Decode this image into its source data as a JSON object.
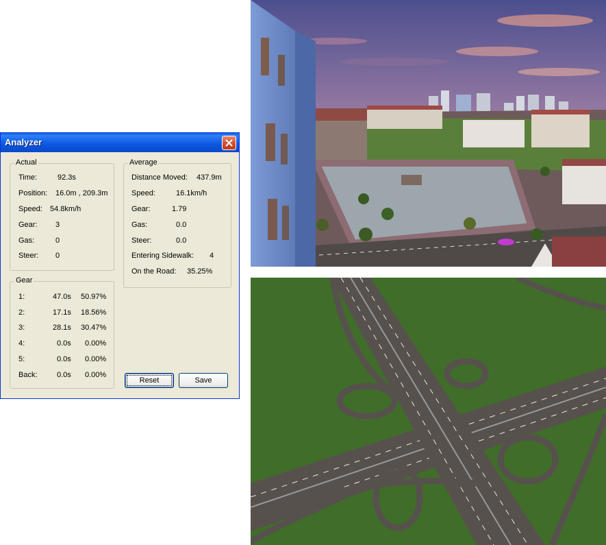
{
  "window": {
    "title": "Analyzer",
    "close_icon": "close-icon"
  },
  "actual": {
    "title": "Actual",
    "rows": [
      {
        "label": "Time:",
        "value": "92.3s"
      },
      {
        "label": "Position:",
        "value": "16.0m , 209.3m"
      },
      {
        "label": "Speed:",
        "value": "54.8km/h"
      },
      {
        "label": "Gear:",
        "value": "3"
      },
      {
        "label": "Gas:",
        "value": "0"
      },
      {
        "label": "Steer:",
        "value": "0"
      }
    ]
  },
  "average": {
    "title": "Average",
    "rows": [
      {
        "label": "Distance Moved:",
        "value": "437.9m"
      },
      {
        "label": "Speed:",
        "value": "16.1km/h"
      },
      {
        "label": "Gear:",
        "value": "1.79"
      },
      {
        "label": "Gas:",
        "value": "0.0"
      },
      {
        "label": "Steer:",
        "value": "0.0"
      },
      {
        "label": "Entering Sidewalk:",
        "value": "4"
      },
      {
        "label": "On the Road:",
        "value": "35.25%"
      }
    ]
  },
  "gear": {
    "title": "Gear",
    "rows": [
      {
        "label": "1:",
        "time": "47.0s",
        "percent": "50.97%"
      },
      {
        "label": "2:",
        "time": "17.1s",
        "percent": "18.56%"
      },
      {
        "label": "3:",
        "time": "28.1s",
        "percent": "30.47%"
      },
      {
        "label": "4:",
        "time": "0.0s",
        "percent": "0.00%"
      },
      {
        "label": "5:",
        "time": "0.0s",
        "percent": "0.00%"
      },
      {
        "label": "Back:",
        "time": "0.0s",
        "percent": "0.00%"
      }
    ]
  },
  "buttons": {
    "reset": "Reset",
    "save": "Save"
  },
  "colors": {
    "title_bar": "#0a56e0",
    "close_button": "#cf4a27",
    "dialog_face": "#ece9d8",
    "sky_top": "#4a4e8c",
    "sky_horizon": "#d98a78",
    "grass": "#3f6b2a",
    "road": "#5a5450"
  }
}
